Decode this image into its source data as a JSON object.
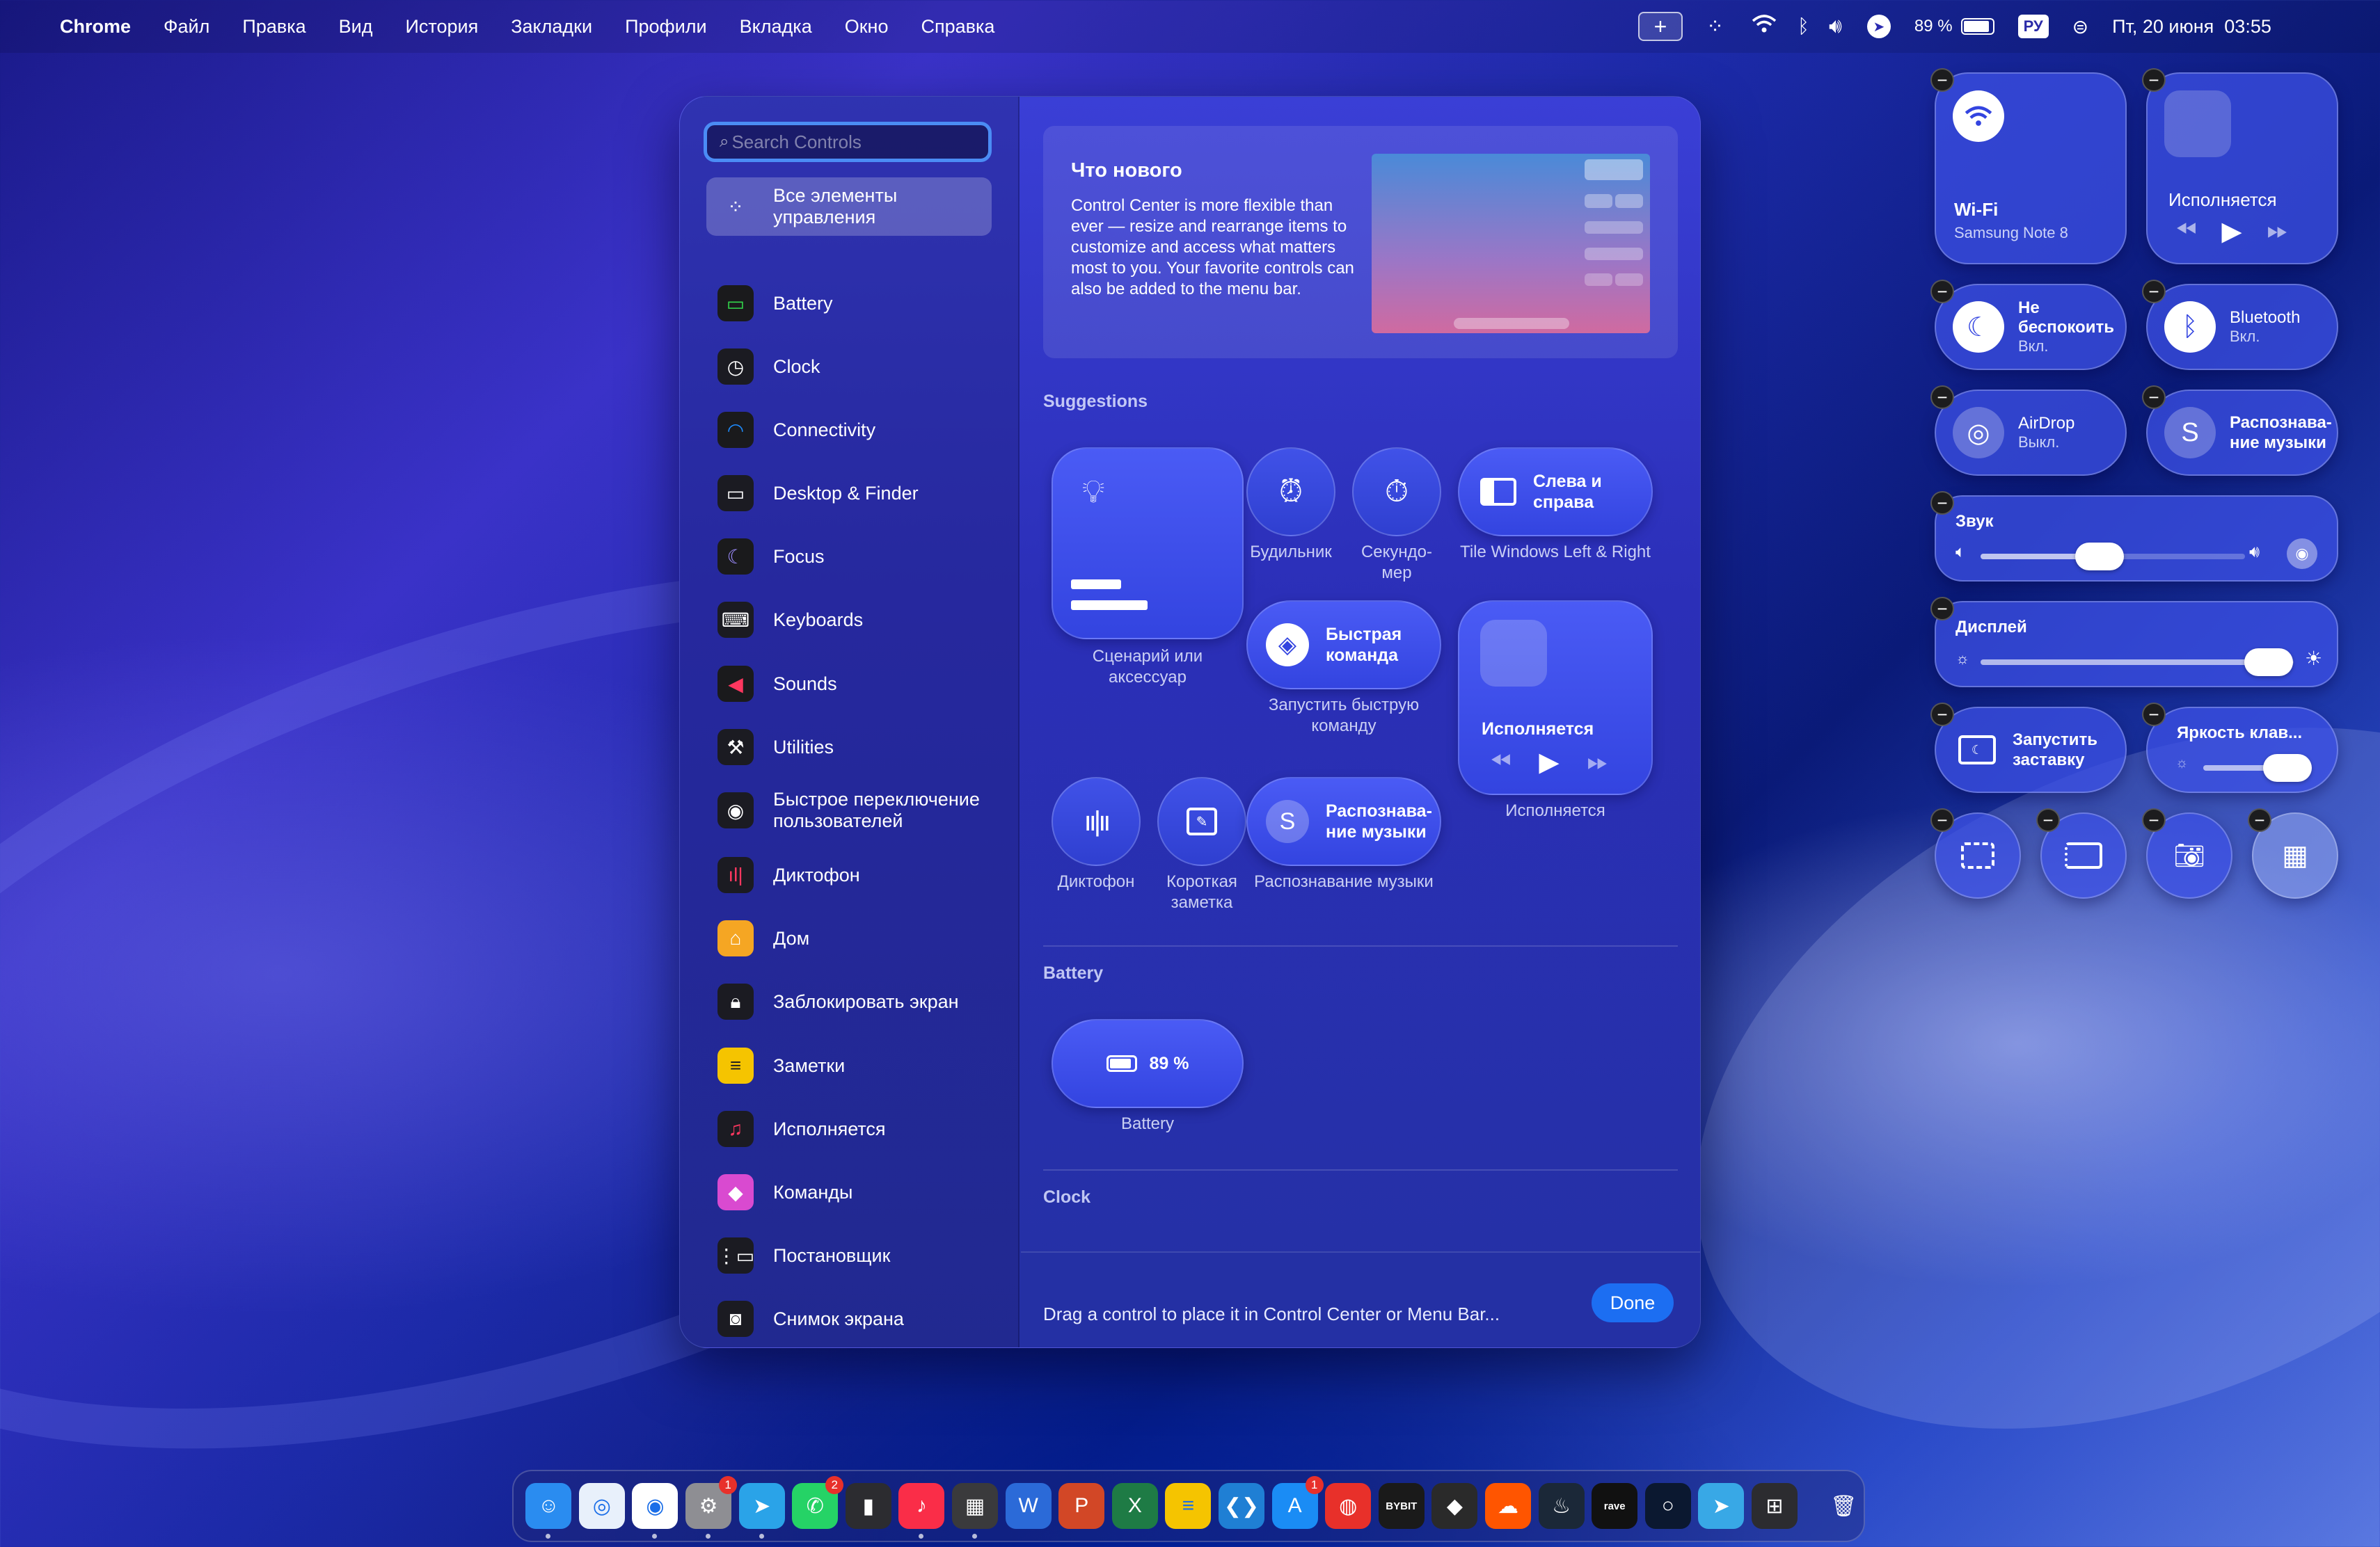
{
  "menubar": {
    "app": "Chrome",
    "items": [
      "Файл",
      "Правка",
      "Вид",
      "История",
      "Закладки",
      "Профили",
      "Вкладка",
      "Окно",
      "Справка"
    ],
    "battery_pct": "89 %",
    "input_lang": "РУ",
    "datetime": "Пт, 20 июня  03:55"
  },
  "sidebar": {
    "search_placeholder": "Search Controls",
    "items": [
      {
        "label": "Все элементы управления",
        "icon": "grid-icon"
      },
      {
        "label": "Battery",
        "icon": "battery-icon"
      },
      {
        "label": "Clock",
        "icon": "clock-icon"
      },
      {
        "label": "Connectivity",
        "icon": "wifi-icon"
      },
      {
        "label": "Desktop & Finder",
        "icon": "desktop-icon"
      },
      {
        "label": "Focus",
        "icon": "moon-icon"
      },
      {
        "label": "Keyboards",
        "icon": "keyboard-icon"
      },
      {
        "label": "Sounds",
        "icon": "speaker-icon"
      },
      {
        "label": "Utilities",
        "icon": "tools-icon"
      },
      {
        "label": "Быстрое переключение пользователей",
        "icon": "user-icon"
      },
      {
        "label": "Диктофон",
        "icon": "waveform-icon"
      },
      {
        "label": "Дом",
        "icon": "home-icon"
      },
      {
        "label": "Заблокировать экран",
        "icon": "lock-icon"
      },
      {
        "label": "Заметки",
        "icon": "notes-icon"
      },
      {
        "label": "Исполняется",
        "icon": "now-playing-icon"
      },
      {
        "label": "Команды",
        "icon": "shortcuts-icon"
      },
      {
        "label": "Постановщик",
        "icon": "stage-manager-icon"
      },
      {
        "label": "Снимок экрана",
        "icon": "screenshot-icon"
      }
    ]
  },
  "whats_new": {
    "title": "Что нового",
    "body": "Control Center is more flexible than ever — resize and rearrange items to customize and access what matters most to you. Your favorite controls can also be added to the menu bar."
  },
  "suggestions": {
    "title": "Suggestions",
    "scene": "Сценарий или аксессуар",
    "alarm": "Будильник",
    "stopwatch": "Секундо-мер",
    "tile_btn": "Слева и справа",
    "tile_cap": "Tile Windows Left & Right",
    "shortcut_btn": "Быстрая команда",
    "shortcut_cap": "Запустить быструю команду",
    "np_title": "Исполняется",
    "np_cap": "Исполняется",
    "voice_memo": "Диктофон",
    "quick_note": "Короткая заметка",
    "shazam_btn": "Распознава-ние музыки",
    "shazam_cap": "Распознавание музыки"
  },
  "battery_section": {
    "title": "Battery",
    "value": "89 %",
    "caption": "Battery"
  },
  "clock_section": {
    "title": "Clock"
  },
  "footer": {
    "hint": "Drag a control to place it in Control Center or Menu Bar...",
    "done": "Done"
  },
  "control_center": {
    "wifi_title": "Wi-Fi",
    "wifi_sub": "Samsung Note 8",
    "np_title": "Исполняется",
    "dnd_title": "Не беспокоить",
    "dnd_sub": "Вкл.",
    "bt_title": "Bluetooth",
    "bt_sub": "Вкл.",
    "airdrop_title": "AirDrop",
    "airdrop_sub": "Выкл.",
    "shazam_title": "Распознава-ние музыки",
    "sound_title": "Звук",
    "sound_level": 0.45,
    "display_title": "Дисплей",
    "display_level": 0.92,
    "screensaver_title": "Запустить заставку",
    "kbd_title": "Яркость клав...",
    "kbd_level": 0.8
  },
  "dock": {
    "apps": [
      {
        "name": "Finder",
        "bg": "#2a8cf0",
        "glyph": "☺"
      },
      {
        "name": "Safari",
        "bg": "#e8f0fb",
        "glyph": "◎"
      },
      {
        "name": "Chrome",
        "bg": "#ffffff",
        "glyph": "◉"
      },
      {
        "name": "System Settings",
        "bg": "#8e8e93",
        "glyph": "⚙",
        "badge": "1"
      },
      {
        "name": "Telegram",
        "bg": "#2aa3e8",
        "glyph": "➤"
      },
      {
        "name": "WhatsApp",
        "bg": "#25d366",
        "glyph": "✆",
        "badge": "2"
      },
      {
        "name": "App",
        "bg": "#2c2c30",
        "glyph": "▮"
      },
      {
        "name": "Music",
        "bg": "#fa2d48",
        "glyph": "♪"
      },
      {
        "name": "Calculator",
        "bg": "#3a3a3c",
        "glyph": "▦"
      },
      {
        "name": "Word",
        "bg": "#2b6ad8",
        "glyph": "W"
      },
      {
        "name": "PowerPoint",
        "bg": "#d24726",
        "glyph": "P"
      },
      {
        "name": "Excel",
        "bg": "#1e7b45",
        "glyph": "X"
      },
      {
        "name": "Notes",
        "bg": "#f5c400",
        "glyph": "≡"
      },
      {
        "name": "VS Code",
        "bg": "#1f7fd4",
        "glyph": "❮❯"
      },
      {
        "name": "App Store",
        "bg": "#1a8cf5",
        "glyph": "A",
        "badge": "1"
      },
      {
        "name": "App",
        "bg": "#e8302a",
        "glyph": "◍"
      },
      {
        "name": "Bybit",
        "bg": "#1a1a1a",
        "glyph": "BYBIT"
      },
      {
        "name": "App",
        "bg": "#2a2a2a",
        "glyph": "◆"
      },
      {
        "name": "SoundCloud",
        "bg": "#ff5500",
        "glyph": "☁"
      },
      {
        "name": "Steam",
        "bg": "#1b2838",
        "glyph": "♨"
      },
      {
        "name": "Rave",
        "bg": "#111111",
        "glyph": "rave"
      },
      {
        "name": "App",
        "bg": "#0b1830",
        "glyph": "○"
      },
      {
        "name": "Telegram",
        "bg": "#38a8e6",
        "glyph": "➤"
      },
      {
        "name": "Launchpad",
        "bg": "#2c2c30",
        "glyph": "⊞"
      },
      {
        "name": "Trash",
        "bg": "transparent",
        "glyph": "🗑"
      }
    ]
  }
}
